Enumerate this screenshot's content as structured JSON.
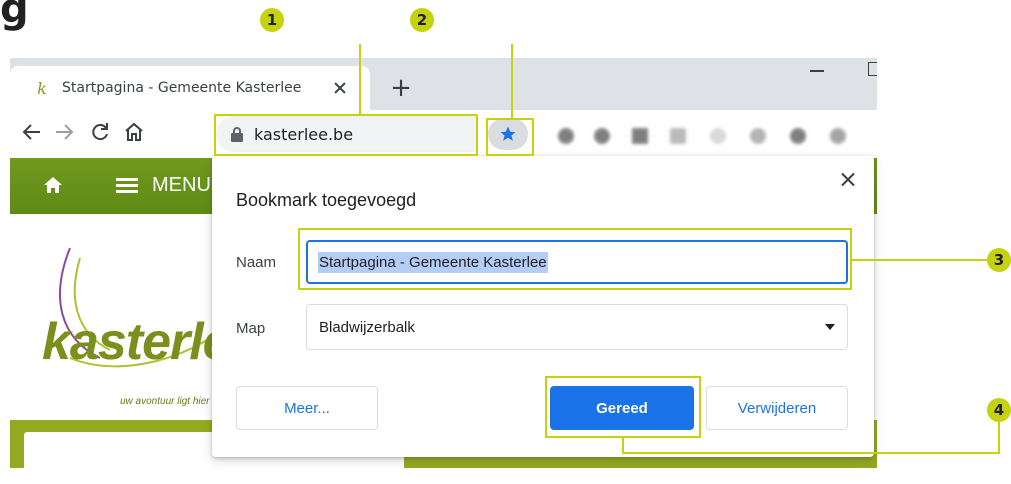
{
  "heading_fragment": "g",
  "tab": {
    "title": "Startpagina - Gemeente Kasterlee",
    "favicon_letter": "k"
  },
  "omnibox": {
    "url": "kasterlee.be"
  },
  "site": {
    "menu_label": "MENU",
    "logo_text": "kasterlee",
    "tagline": "uw avontuur ligt hier"
  },
  "dialog": {
    "title": "Bookmark toegevoegd",
    "name_label": "Naam",
    "name_value": "Startpagina - Gemeente Kasterlee",
    "folder_label": "Map",
    "folder_value": "Bladwijzerbalk",
    "more_label": "Meer...",
    "done_label": "Gereed",
    "remove_label": "Verwijderen"
  },
  "annotations": {
    "marker_1": "1",
    "marker_2": "2",
    "marker_3": "3",
    "marker_4": "4"
  },
  "colors": {
    "accent_blue": "#1a73e8",
    "annotation_yellow": "#c5d20f",
    "site_green": "#6f9a1e"
  }
}
